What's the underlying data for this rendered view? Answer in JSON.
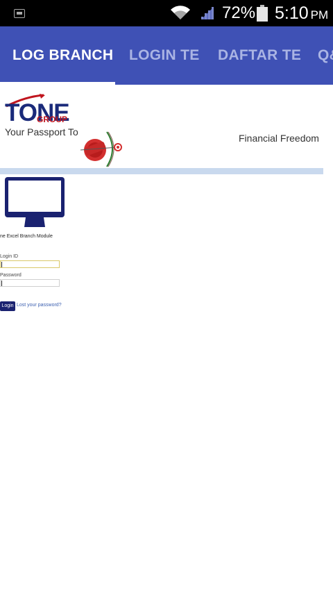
{
  "status_bar": {
    "battery_percent": "72%",
    "time": "5:10",
    "ampm": "PM",
    "icons": [
      "notification-icon",
      "wifi-icon",
      "signal-icon",
      "battery-icon"
    ]
  },
  "tabs": [
    {
      "label": "LOG BRANCH",
      "active": true
    },
    {
      "label": "LOGIN TE",
      "active": false
    },
    {
      "label": "DAFTAR TE",
      "active": false
    },
    {
      "label": "Q&",
      "active": false
    }
  ],
  "header": {
    "logo_text": "TONE",
    "logo_sub": "GROUP",
    "tagline_left": "Your Passport To",
    "tagline_right": "Financial Freedom",
    "emblem_icon": "financial-freedom-arrow-emblem"
  },
  "login": {
    "module_title": "ne Excel Branch Module",
    "login_id_label": "Login ID",
    "password_label": "Password",
    "login_id_value": "",
    "password_value": "",
    "login_button": "Login",
    "lost_password_link": "Lost your password?"
  },
  "colors": {
    "tab_bar": "#3f51b5",
    "tab_active": "#ffffff",
    "tab_inactive": "#aab4e4",
    "logo_navy": "#1a2a7a",
    "logo_red": "#c0151e",
    "divider": "#c9d9ee",
    "monitor": "#1a2270"
  }
}
